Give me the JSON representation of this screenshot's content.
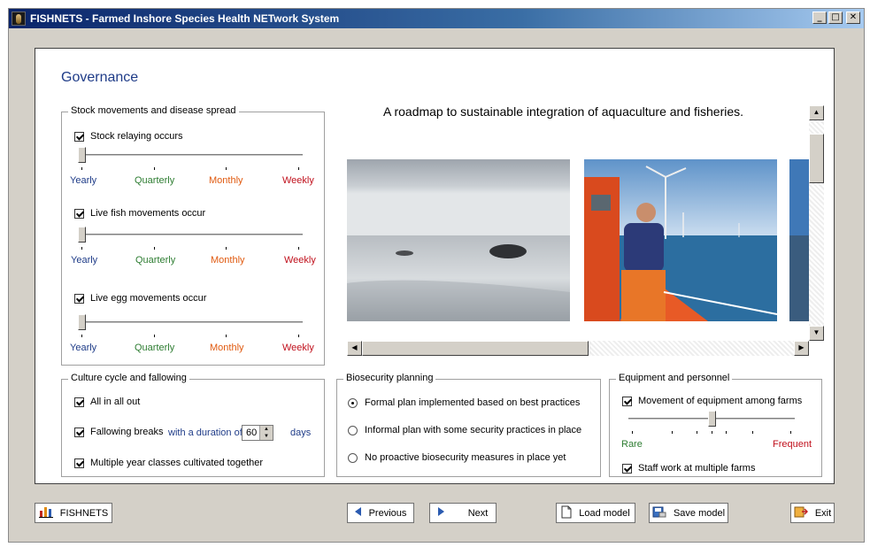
{
  "window": {
    "title": "FISHNETS - Farmed Inshore Species Health NETwork System",
    "controls": {
      "minimize": "_",
      "maximize": "□",
      "close": "✕"
    }
  },
  "page": {
    "title": "Governance"
  },
  "stock": {
    "legend": "Stock movements and disease spread",
    "items": [
      {
        "label": "Stock relaying occurs",
        "checked": true,
        "level": "Yearly"
      },
      {
        "label": "Live fish movements occur",
        "checked": true,
        "level": "Yearly"
      },
      {
        "label": "Live egg movements occur",
        "checked": true,
        "level": "Yearly"
      }
    ],
    "scale": [
      "Yearly",
      "Quarterly",
      "Monthly",
      "Weekly"
    ]
  },
  "roadmap": {
    "title": "A roadmap to sustainable integration of aquaculture and fisheries."
  },
  "culture": {
    "legend": "Culture cycle and fallowing",
    "all_in_all_out": "All in all out",
    "fallowing": "Fallowing breaks",
    "duration_prefix": "with a duration of",
    "duration_value": "60",
    "duration_unit": "days",
    "multiple_year": "Multiple year classes cultivated together"
  },
  "biosecurity": {
    "legend": "Biosecurity planning",
    "options": [
      {
        "label": "Formal plan implemented based on best practices",
        "selected": true
      },
      {
        "label": "Informal plan with some security practices in place",
        "selected": false
      },
      {
        "label": "No proactive biosecurity measures in place yet",
        "selected": false
      }
    ]
  },
  "equipment": {
    "legend": "Equipment and personnel",
    "movement": "Movement of equipment among farms",
    "rare": "Rare",
    "frequent": "Frequent",
    "slider_value": 0.5,
    "staff": "Staff work at multiple farms"
  },
  "buttons": {
    "fishnets": "FISHNETS",
    "previous": "Previous",
    "next": "Next",
    "load": "Load model",
    "save": "Save model",
    "exit": "Exit"
  },
  "colors": {
    "yearly": "#1f3c88",
    "quarterly": "#2e7d32",
    "monthly": "#e05a10",
    "weekly": "#c0101c"
  }
}
